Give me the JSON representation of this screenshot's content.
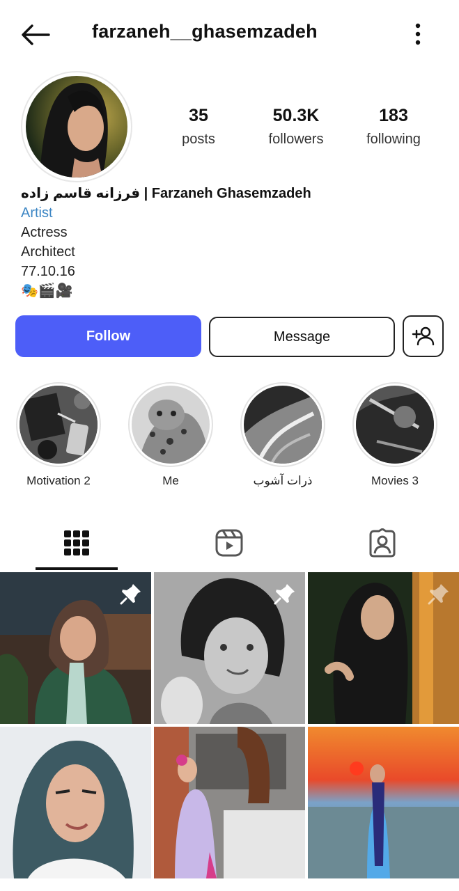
{
  "header": {
    "username": "farzaneh__ghasemzadeh",
    "back_icon": "back-arrow-icon",
    "more_icon": "more-vertical-icon"
  },
  "stats": {
    "posts_value": "35",
    "posts_label": "posts",
    "followers_value": "50.3K",
    "followers_label": "followers",
    "following_value": "183",
    "following_label": "following"
  },
  "bio": {
    "name": "فرزانه قاسم زاده | Farzaneh Ghasemzadeh",
    "category": "Artist",
    "lines": [
      "Actress",
      "Architect",
      "77.10.16"
    ],
    "emoji": "🎭🎬🎥"
  },
  "actions": {
    "follow_label": "Follow",
    "message_label": "Message",
    "add_user_icon": "add-user-icon"
  },
  "highlights": [
    {
      "label": "Motivation 2"
    },
    {
      "label": "Me"
    },
    {
      "label": "ذرات آشوب"
    },
    {
      "label": "Movies 3"
    }
  ],
  "tabs": [
    {
      "icon": "grid-icon",
      "active": true
    },
    {
      "icon": "reels-icon",
      "active": false
    },
    {
      "icon": "tagged-icon",
      "active": false
    }
  ],
  "posts": [
    {
      "pinned": true
    },
    {
      "pinned": true
    },
    {
      "pinned": true
    },
    {
      "pinned": false
    },
    {
      "pinned": false
    },
    {
      "pinned": false
    }
  ],
  "colors": {
    "follow_button": "#4d5ef8",
    "category_link": "#3c86c4"
  }
}
